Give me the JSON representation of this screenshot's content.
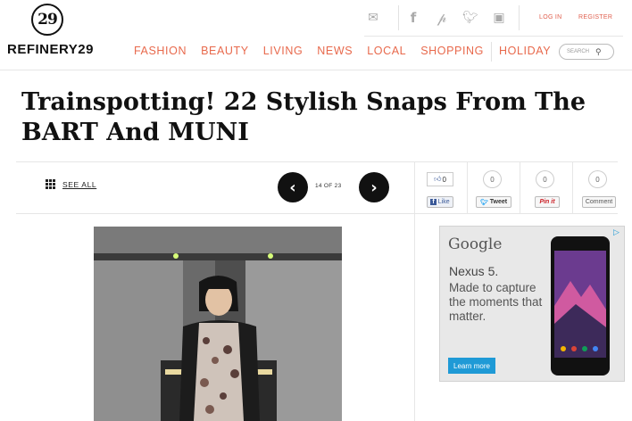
{
  "brand": {
    "logo_mark": "29",
    "name": "REFINERY29"
  },
  "social": [
    "mail-icon",
    "facebook-icon",
    "pinterest-icon",
    "twitter-icon",
    "instagram-icon"
  ],
  "auth": {
    "login": "LOG IN",
    "register": "REGISTER"
  },
  "nav": [
    "FASHION",
    "BEAUTY",
    "LIVING",
    "NEWS",
    "LOCAL",
    "SHOPPING",
    "HOLIDAY"
  ],
  "search": {
    "placeholder": "SEARCH"
  },
  "article": {
    "title": "Trainspotting! 22 Stylish Snaps From The BART And MUNI"
  },
  "gallery": {
    "see_all": "SEE ALL",
    "counter": "14 OF 23"
  },
  "share": [
    {
      "count": "0",
      "label": "Like"
    },
    {
      "count": "0",
      "label": "Tweet"
    },
    {
      "count": "0",
      "label": "Pin it"
    },
    {
      "count": "0",
      "label": "Comment"
    }
  ],
  "ad": {
    "brand": "Google",
    "product": "Nexus 5.",
    "copy": "Made to capture the moments that matter.",
    "cta": "Learn more"
  },
  "colors": {
    "accent": "#e8694c",
    "dark": "#111111",
    "ad_blue": "#1f9ad6"
  }
}
